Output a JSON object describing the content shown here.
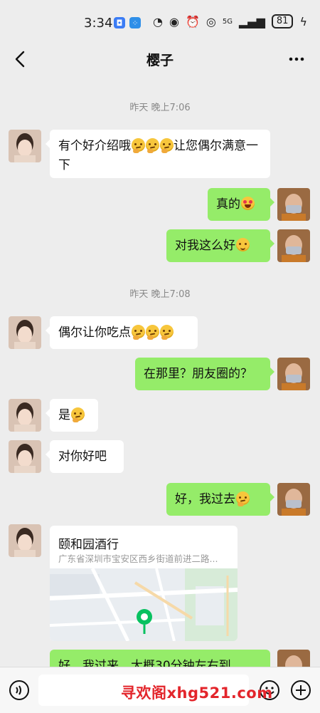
{
  "status": {
    "time": "3:34",
    "network": "5G",
    "battery": "81"
  },
  "header": {
    "title": "樱子"
  },
  "timestamps": [
    "昨天 晚上7:06",
    "昨天 晚上7:08"
  ],
  "messages": [
    {
      "side": "left",
      "text": "有个好介绍哦",
      "text2": "让您偶尔满意一下"
    },
    {
      "side": "right",
      "text": "真的"
    },
    {
      "side": "right",
      "text": "对我这么好"
    },
    {
      "side": "left",
      "text": "偶尔让你吃点"
    },
    {
      "side": "right",
      "text": "在那里？朋友圈的？"
    },
    {
      "side": "left",
      "text": "是"
    },
    {
      "side": "left",
      "text": "对你好吧"
    },
    {
      "side": "right",
      "text": "好，我过去"
    },
    {
      "side": "right",
      "text": "好，我过来，大概30分钟左右到"
    }
  ],
  "location": {
    "name": "颐和园酒行",
    "address": "广东省深圳市宝安区西乡街道前进二路..."
  },
  "watermark": "寻欢阁xhg521.com",
  "colors": {
    "background": "#ededed",
    "bubble_right": "#95ec69",
    "bubble_left": "#ffffff",
    "pin": "#07c160"
  }
}
